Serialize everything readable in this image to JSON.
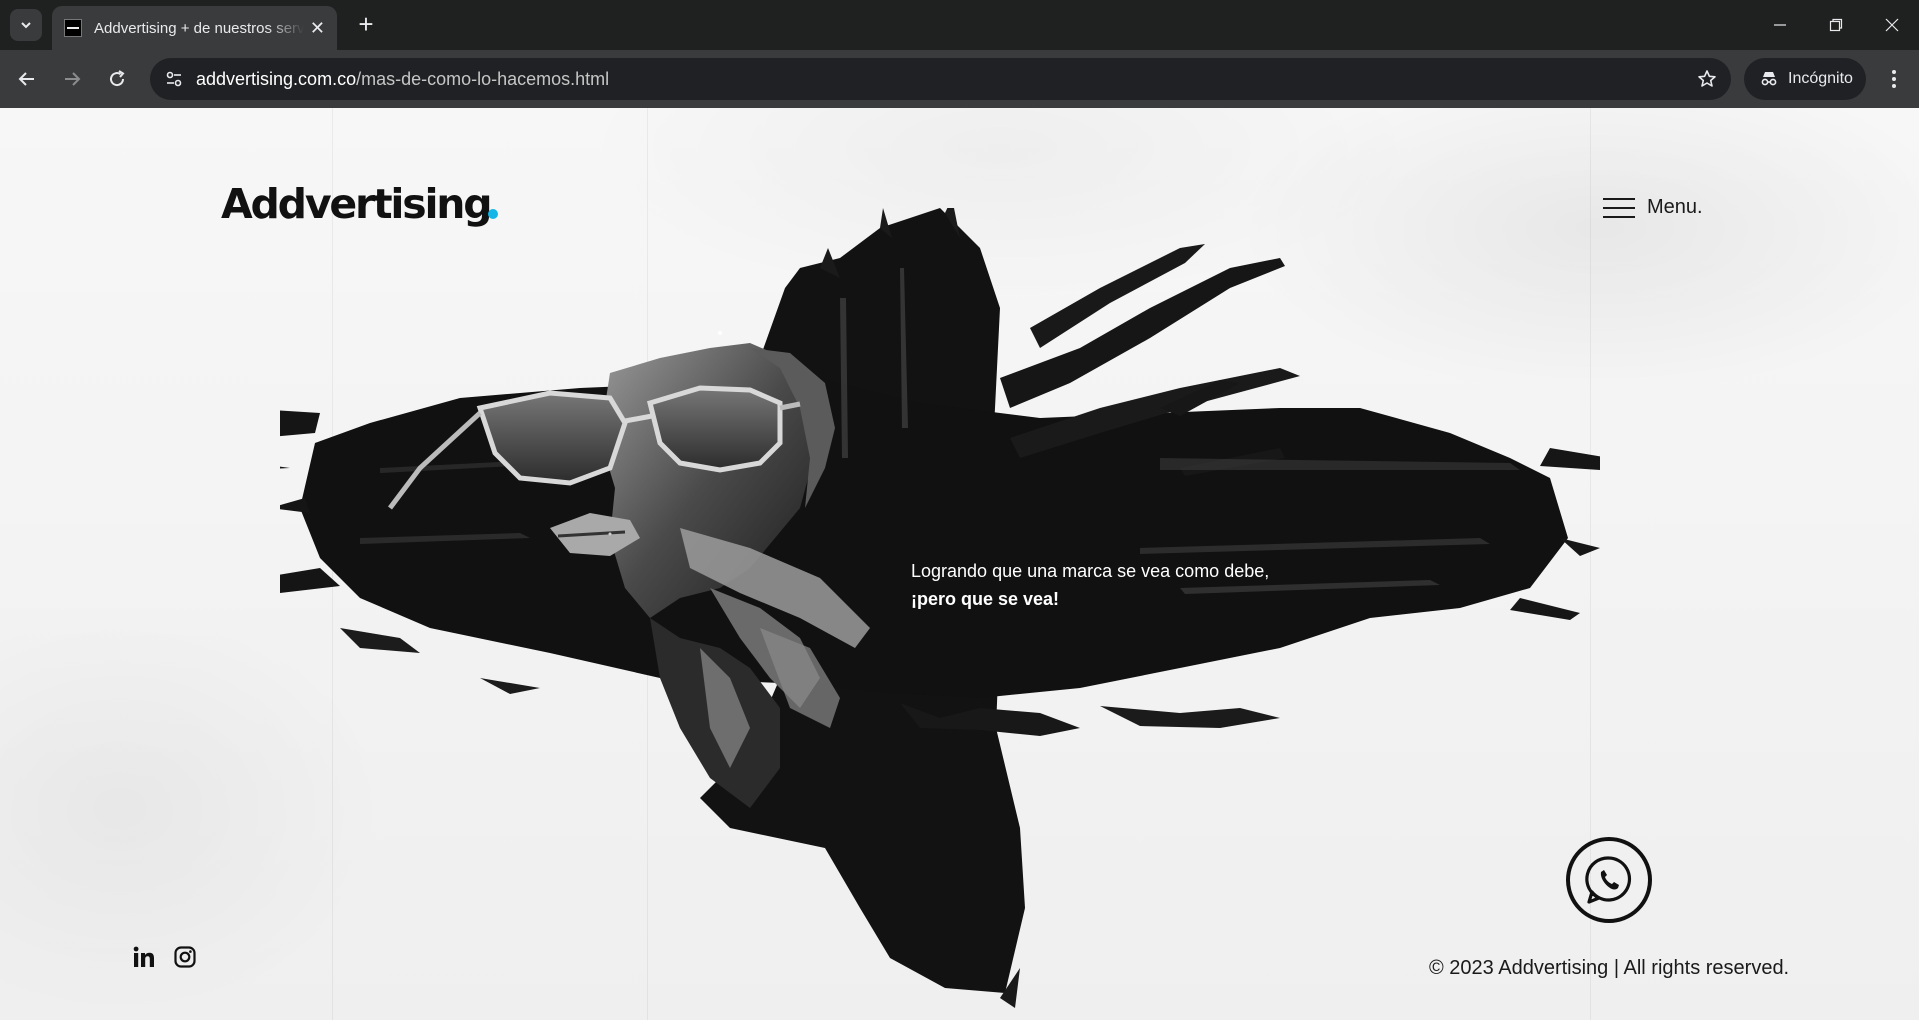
{
  "browser": {
    "tab_title": "Addvertising + de nuestros servicios",
    "url_host": "addvertising.com.co",
    "url_path": "/mas-de-como-lo-hacemos.html",
    "incognito_label": "Incógnito",
    "icons": [
      "tab-search-icon",
      "close-icon",
      "plus-icon",
      "minimize-icon",
      "restore-icon",
      "back-icon",
      "forward-icon",
      "reload-icon",
      "site-info-icon",
      "star-icon",
      "incognito-icon",
      "kebab-menu-icon"
    ]
  },
  "page": {
    "logo": "Addvertising",
    "logo_dot_color": "#13b6e6",
    "menu_label": "Menu.",
    "tagline_line1": "Logrando que una marca se vea como debe,",
    "tagline_line2": "¡pero que se vea!",
    "copyright": "© 2023 Addvertising | All rights reserved.",
    "social": [
      "linkedin-icon",
      "instagram-icon"
    ],
    "floating_action": "whatsapp-icon"
  }
}
